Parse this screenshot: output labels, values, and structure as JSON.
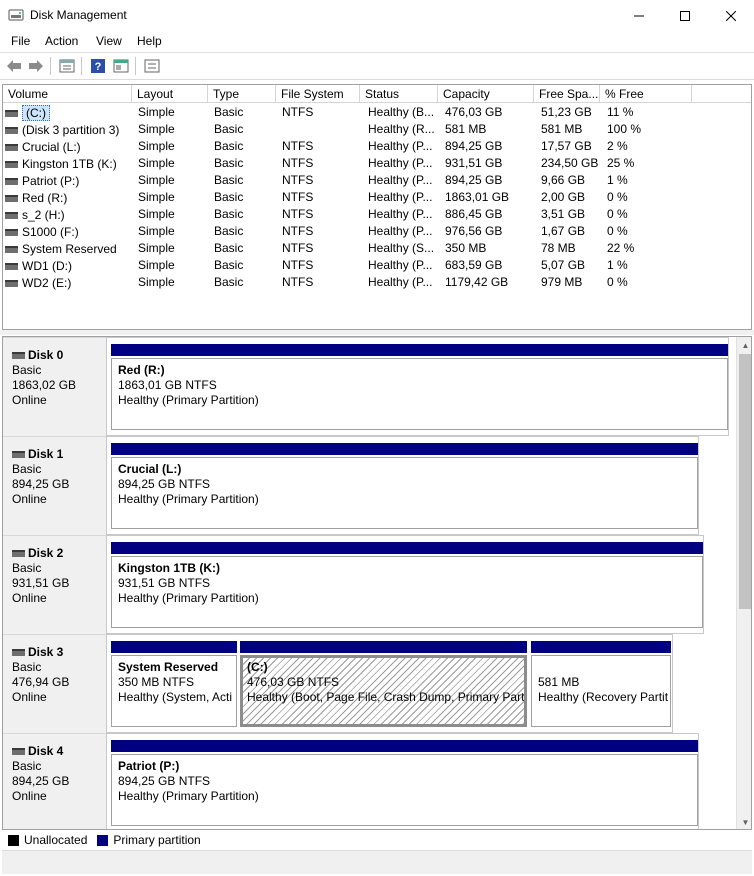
{
  "window": {
    "title": "Disk Management"
  },
  "menu": [
    "File",
    "Action",
    "View",
    "Help"
  ],
  "columns": [
    "Volume",
    "Layout",
    "Type",
    "File System",
    "Status",
    "Capacity",
    "Free Spa...",
    "% Free"
  ],
  "volumes": [
    {
      "volume": "(C:)",
      "layout": "Simple",
      "type": "Basic",
      "fs": "NTFS",
      "status": "Healthy (B...",
      "capacity": "476,03 GB",
      "free": "51,23 GB",
      "pct": "11 %"
    },
    {
      "volume": "(Disk 3 partition 3)",
      "layout": "Simple",
      "type": "Basic",
      "fs": "",
      "status": "Healthy (R...",
      "capacity": "581 MB",
      "free": "581 MB",
      "pct": "100 %"
    },
    {
      "volume": "Crucial (L:)",
      "layout": "Simple",
      "type": "Basic",
      "fs": "NTFS",
      "status": "Healthy (P...",
      "capacity": "894,25 GB",
      "free": "17,57 GB",
      "pct": "2 %"
    },
    {
      "volume": "Kingston 1TB (K:)",
      "layout": "Simple",
      "type": "Basic",
      "fs": "NTFS",
      "status": "Healthy (P...",
      "capacity": "931,51 GB",
      "free": "234,50 GB",
      "pct": "25 %"
    },
    {
      "volume": "Patriot (P:)",
      "layout": "Simple",
      "type": "Basic",
      "fs": "NTFS",
      "status": "Healthy (P...",
      "capacity": "894,25 GB",
      "free": "9,66 GB",
      "pct": "1 %"
    },
    {
      "volume": "Red (R:)",
      "layout": "Simple",
      "type": "Basic",
      "fs": "NTFS",
      "status": "Healthy (P...",
      "capacity": "1863,01 GB",
      "free": "2,00 GB",
      "pct": "0 %"
    },
    {
      "volume": "s_2 (H:)",
      "layout": "Simple",
      "type": "Basic",
      "fs": "NTFS",
      "status": "Healthy (P...",
      "capacity": "886,45 GB",
      "free": "3,51 GB",
      "pct": "0 %"
    },
    {
      "volume": "S1000 (F:)",
      "layout": "Simple",
      "type": "Basic",
      "fs": "NTFS",
      "status": "Healthy (P...",
      "capacity": "976,56 GB",
      "free": "1,67 GB",
      "pct": "0 %"
    },
    {
      "volume": "System Reserved",
      "layout": "Simple",
      "type": "Basic",
      "fs": "NTFS",
      "status": "Healthy (S...",
      "capacity": "350 MB",
      "free": "78 MB",
      "pct": "22 %"
    },
    {
      "volume": "WD1 (D:)",
      "layout": "Simple",
      "type": "Basic",
      "fs": "NTFS",
      "status": "Healthy (P...",
      "capacity": "683,59 GB",
      "free": "5,07 GB",
      "pct": "1 %"
    },
    {
      "volume": "WD2 (E:)",
      "layout": "Simple",
      "type": "Basic",
      "fs": "NTFS",
      "status": "Healthy (P...",
      "capacity": "1179,42 GB",
      "free": "979 MB",
      "pct": "0 %"
    }
  ],
  "disks": [
    {
      "name": "Disk 0",
      "type": "Basic",
      "size": "1863,02 GB",
      "state": "Online",
      "partitions": [
        {
          "name": "Red  (R:)",
          "size": "1863,01 GB NTFS",
          "status": "Healthy (Primary Partition)"
        }
      ]
    },
    {
      "name": "Disk 1",
      "type": "Basic",
      "size": "894,25 GB",
      "state": "Online",
      "partitions": [
        {
          "name": "Crucial  (L:)",
          "size": "894,25 GB NTFS",
          "status": "Healthy (Primary Partition)"
        }
      ]
    },
    {
      "name": "Disk 2",
      "type": "Basic",
      "size": "931,51 GB",
      "state": "Online",
      "partitions": [
        {
          "name": "Kingston 1TB  (K:)",
          "size": "931,51 GB NTFS",
          "status": "Healthy (Primary Partition)"
        }
      ]
    },
    {
      "name": "Disk 3",
      "type": "Basic",
      "size": "476,94 GB",
      "state": "Online",
      "partitions": [
        {
          "name": "System Reserved",
          "size": "350 MB NTFS",
          "status": "Healthy (System, Acti"
        },
        {
          "name": "(C:)",
          "size": "476,03 GB NTFS",
          "status": "Healthy (Boot, Page File, Crash Dump, Primary Partit"
        },
        {
          "name": "",
          "size": "581 MB",
          "status": "Healthy (Recovery Partit"
        }
      ]
    },
    {
      "name": "Disk 4",
      "type": "Basic",
      "size": "894,25 GB",
      "state": "Online",
      "partitions": [
        {
          "name": "Patriot  (P:)",
          "size": "894,25 GB NTFS",
          "status": "Healthy (Primary Partition)"
        }
      ]
    }
  ],
  "legend": [
    {
      "label": "Unallocated",
      "color": "#000000"
    },
    {
      "label": "Primary partition",
      "color": "#000080"
    }
  ],
  "icons": [
    "disk-management-icon",
    "minimize-icon",
    "maximize-icon",
    "close-icon",
    "back-icon",
    "forward-icon",
    "properties-icon",
    "help-icon",
    "view-icon",
    "settings-icon"
  ],
  "colors": {
    "partition_bar": "#000080",
    "selection": "#cce4f7"
  }
}
